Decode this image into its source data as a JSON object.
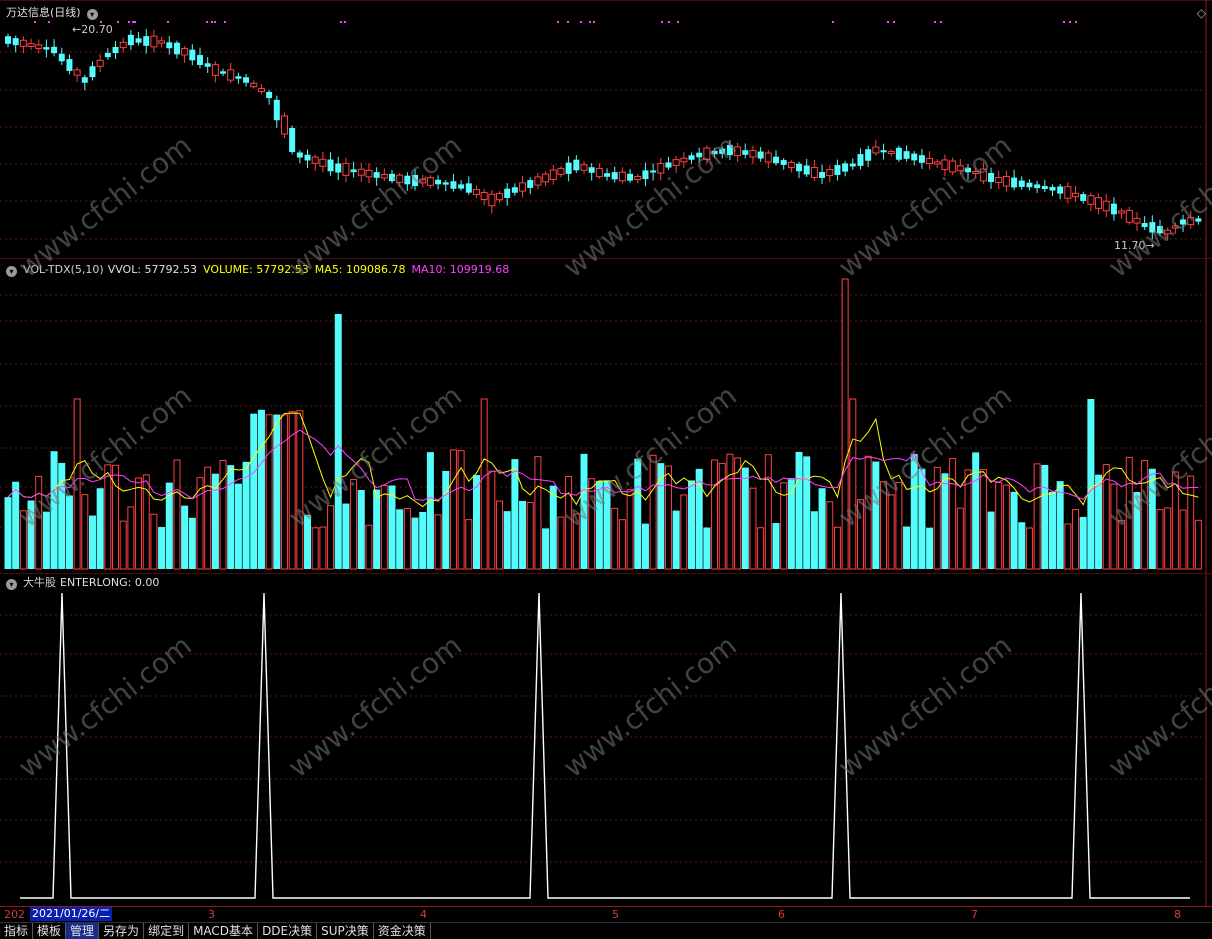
{
  "price_panel": {
    "title": "万达信息(日线)",
    "high_label": "20.70",
    "low_label": "11.70",
    "corner_icon": "diamond-icon"
  },
  "volume_panel": {
    "name": "VOL-TDX(5,10)",
    "vvol": "VVOL: 57792.53",
    "volume": "VOLUME: 57792.53",
    "ma5": "MA5: 109086.78",
    "ma10": "MA10: 109919.68"
  },
  "signal_panel": {
    "name": "大牛股",
    "enterlong": "ENTERLONG: 0.00"
  },
  "time_axis": {
    "year_prefix": "202",
    "cursor_date": "2021/01/26/二",
    "months": [
      "3",
      "4",
      "5",
      "6",
      "7",
      "8"
    ]
  },
  "watermark": "www.cfchi.com",
  "tabs": [
    "指标",
    "模板",
    "管理",
    "另存为",
    "绑定到",
    "MACD基本",
    "DDE决策",
    "SUP决策",
    "资金决策"
  ],
  "colors": {
    "up": "#ff4040",
    "down": "#54fcfc",
    "ma5": "#ffff00",
    "ma10": "#ff40ff",
    "signal": "#ffffff",
    "grid": "#8c1a1a"
  },
  "chart_data": {
    "type": "candlestick",
    "price_range": [
      11.7,
      20.7
    ],
    "enterlong_signals": 5
  }
}
